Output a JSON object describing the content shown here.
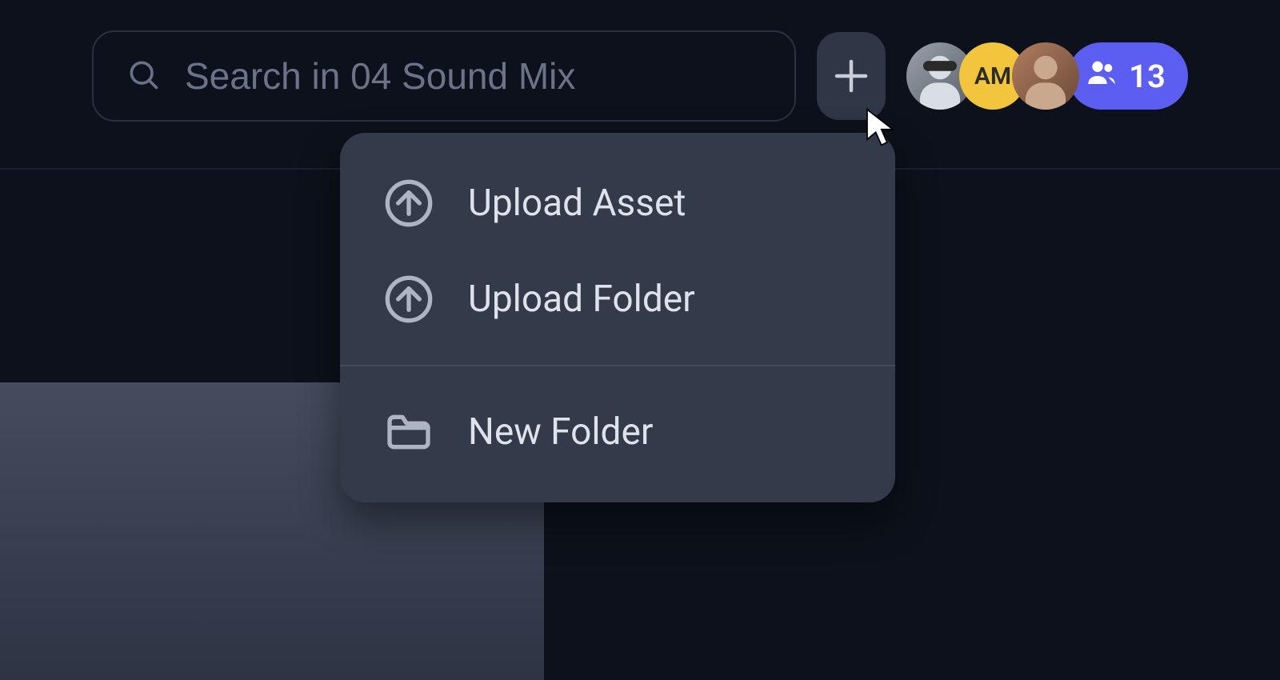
{
  "search": {
    "placeholder": "Search in 04 Sound Mix",
    "value": ""
  },
  "avatars": [
    {
      "initials": "",
      "style": "photo-1"
    },
    {
      "initials": "AM",
      "style": "initials"
    },
    {
      "initials": "",
      "style": "photo-2"
    }
  ],
  "collaborator_count": 13,
  "add_menu": {
    "upload_asset": "Upload Asset",
    "upload_folder": "Upload Folder",
    "new_folder": "New Folder"
  }
}
